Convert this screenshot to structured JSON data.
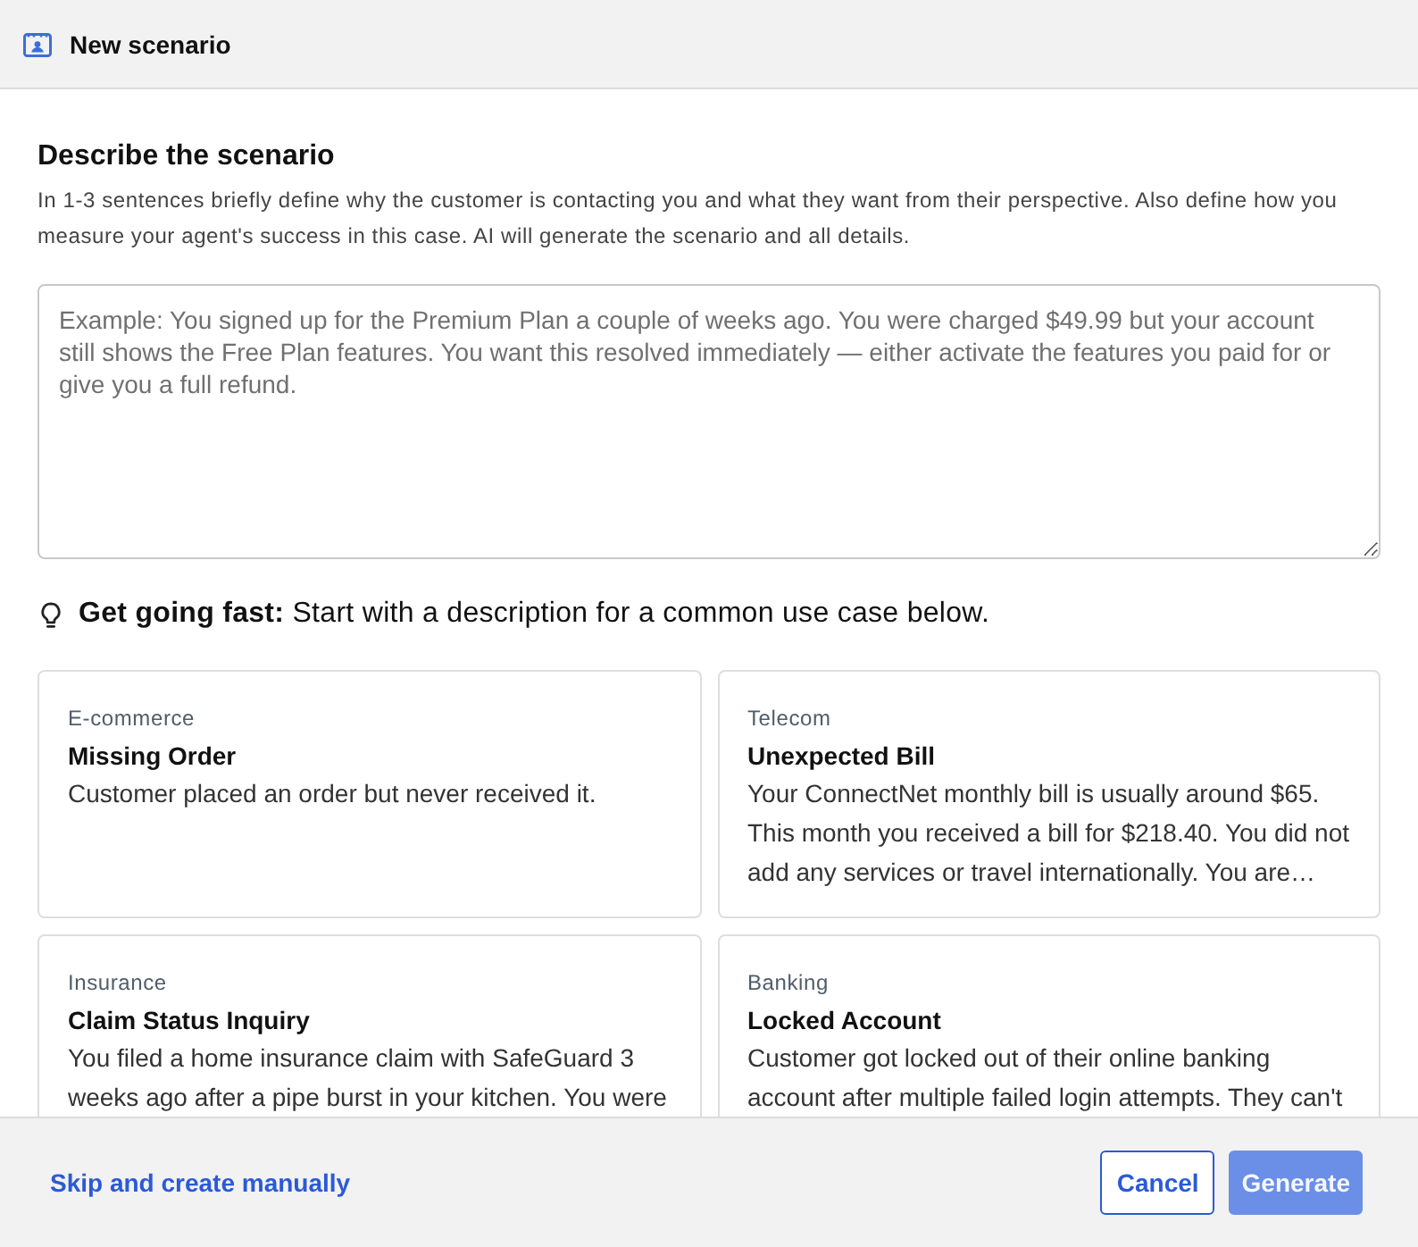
{
  "dialog": {
    "title": "New scenario"
  },
  "describe": {
    "heading": "Describe the scenario",
    "description": "In 1-3 sentences briefly define why the customer is contacting you and what they want from their perspective. Also define how you measure your agent's success in this case. AI will generate the scenario and all details.",
    "field": {
      "placeholder": "Example: You signed up for the Premium Plan a couple of weeks ago. You were charged $49.99 but your account still shows the Free Plan features. You want this resolved immediately — either activate the features you paid for or give you a full refund."
    }
  },
  "quick_start": {
    "text": "**Get going fast:** Start with a description for a common use case below."
  },
  "templates": [
    {
      "category": "E-commerce",
      "title": "Missing Order",
      "description": "Customer placed an order but never received it."
    },
    {
      "category": "Telecom",
      "title": "Unexpected Bill",
      "description": "Your ConnectNet monthly bill is usually around $65. This month you received a bill for $218.40. You did not add any services or travel internationally. You are…"
    },
    {
      "category": "Insurance",
      "title": "Claim Status Inquiry",
      "description": "You filed a home insurance claim with SafeGuard 3 weeks ago after a pipe burst in your kitchen. You were"
    },
    {
      "category": "Banking",
      "title": "Locked Account",
      "description": "Customer got locked out of their online banking account after multiple failed login attempts. They can't"
    }
  ],
  "footer": {
    "link": "Skip and create manually",
    "buttons": [
      {
        "label": "Cancel",
        "kind": "outline",
        "disabled": false
      },
      {
        "label": "Generate",
        "kind": "primary",
        "disabled": true
      }
    ]
  }
}
